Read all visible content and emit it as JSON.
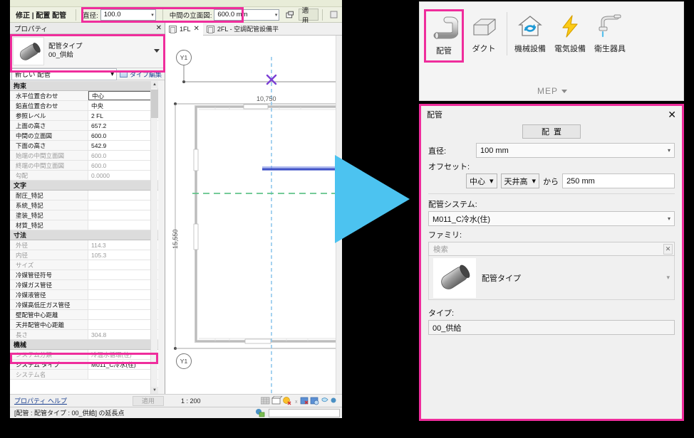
{
  "left": {
    "contextual_tab": "修正 | 配置 配管",
    "options": {
      "diameter_label": "直径:",
      "diameter_value": "100.0",
      "elevation_label": "中間の立面図:",
      "elevation_value": "600.0 mm",
      "apply_label": "適用"
    },
    "view_tabs": [
      {
        "label": "1FL",
        "active": true
      },
      {
        "label": "2FL - 空調配管設備平",
        "active": false
      }
    ],
    "properties": {
      "title": "プロパティ",
      "type_family": "配管タイプ",
      "type_name": "00_供給",
      "new_element": "新しい 配管",
      "edit_type": "タイプ編集",
      "groups": [
        {
          "name": "拘束",
          "rows": [
            {
              "name": "水平位置合わせ",
              "value": "中心",
              "dim": false,
              "editing": true
            },
            {
              "name": "鉛直位置合わせ",
              "value": "中央",
              "dim": false
            },
            {
              "name": "参照レベル",
              "value": "2 FL",
              "dim": false
            },
            {
              "name": "上面の高さ",
              "value": "657.2",
              "dim": false
            },
            {
              "name": "中間の立面図",
              "value": "600.0",
              "dim": false
            },
            {
              "name": "下面の高さ",
              "value": "542.9",
              "dim": false
            },
            {
              "name": "始端の中間立面図",
              "value": "600.0",
              "dim": true
            },
            {
              "name": "終端の中間立面図",
              "value": "600.0",
              "dim": true
            },
            {
              "name": "勾配",
              "value": "0.0000",
              "dim": true
            }
          ]
        },
        {
          "name": "文字",
          "rows": [
            {
              "name": "耐圧_特記",
              "value": "",
              "dim": false
            },
            {
              "name": "系統_特記",
              "value": "",
              "dim": false
            },
            {
              "name": "塗装_特記",
              "value": "",
              "dim": false
            },
            {
              "name": "材質_特記",
              "value": "",
              "dim": false
            }
          ]
        },
        {
          "name": "寸法",
          "rows": [
            {
              "name": "外径",
              "value": "114.3",
              "dim": true
            },
            {
              "name": "内径",
              "value": "105.3",
              "dim": true
            },
            {
              "name": "サイズ",
              "value": "",
              "dim": true
            },
            {
              "name": "冷媒管径符号",
              "value": "",
              "dim": false
            },
            {
              "name": "冷媒ガス管径",
              "value": "",
              "dim": false
            },
            {
              "name": "冷媒液管径",
              "value": "",
              "dim": false
            },
            {
              "name": "冷媒高低圧ガス管径",
              "value": "",
              "dim": false
            },
            {
              "name": "壁配管中心距離",
              "value": "",
              "dim": false
            },
            {
              "name": "天井配管中心距離",
              "value": "",
              "dim": false
            },
            {
              "name": "長さ",
              "value": "304.8",
              "dim": true
            }
          ]
        },
        {
          "name": "機械",
          "rows": [
            {
              "name": "システム分類",
              "value": "冷温水循環(往)",
              "dim": true
            },
            {
              "name": "システム タイプ",
              "value": "M011_C冷水(往)",
              "dim": false,
              "highlight": true
            },
            {
              "name": "システム名",
              "value": "",
              "dim": true
            }
          ]
        }
      ],
      "help_link": "プロパティ ヘルプ",
      "apply_button": "適用"
    },
    "canvas": {
      "grid_top": "Y1",
      "grid_bottom": "Y1",
      "dim_horizontal": "10,750",
      "dim_vertical": "15,550",
      "scale": "1 : 200"
    },
    "status_bar": "[配管 : 配管タイプ : 00_供給] の延長点"
  },
  "right": {
    "ribbon": {
      "items": [
        {
          "label": "配管",
          "icon": "pipe-icon",
          "selected": true
        },
        {
          "label": "ダクト",
          "icon": "duct-icon",
          "selected": false
        },
        {
          "label": "機械設備",
          "icon": "mechanical-icon",
          "selected": false
        },
        {
          "label": "電気設備",
          "icon": "electrical-icon",
          "selected": false
        },
        {
          "label": "衛生器具",
          "icon": "plumbing-fixture-icon",
          "selected": false
        }
      ],
      "panel_label": "MEP"
    },
    "dialog": {
      "title": "配管",
      "tab": "配置",
      "diameter_label": "直径:",
      "diameter_value": "100 mm",
      "offset_label": "オフセット:",
      "offset_justify": "中心",
      "offset_base": "天井高",
      "offset_from": "から",
      "offset_value": "250 mm",
      "system_label": "配管システム:",
      "system_value": "M011_C冷水(住)",
      "family_label": "ファミリ:",
      "search_placeholder": "検索",
      "family_name": "配管タイプ",
      "type_label": "タイプ:",
      "type_value": "00_供給"
    }
  },
  "colors": {
    "highlight": "#ef2d9c",
    "arrow": "#4cc3f0",
    "link": "#1a3f8f"
  }
}
